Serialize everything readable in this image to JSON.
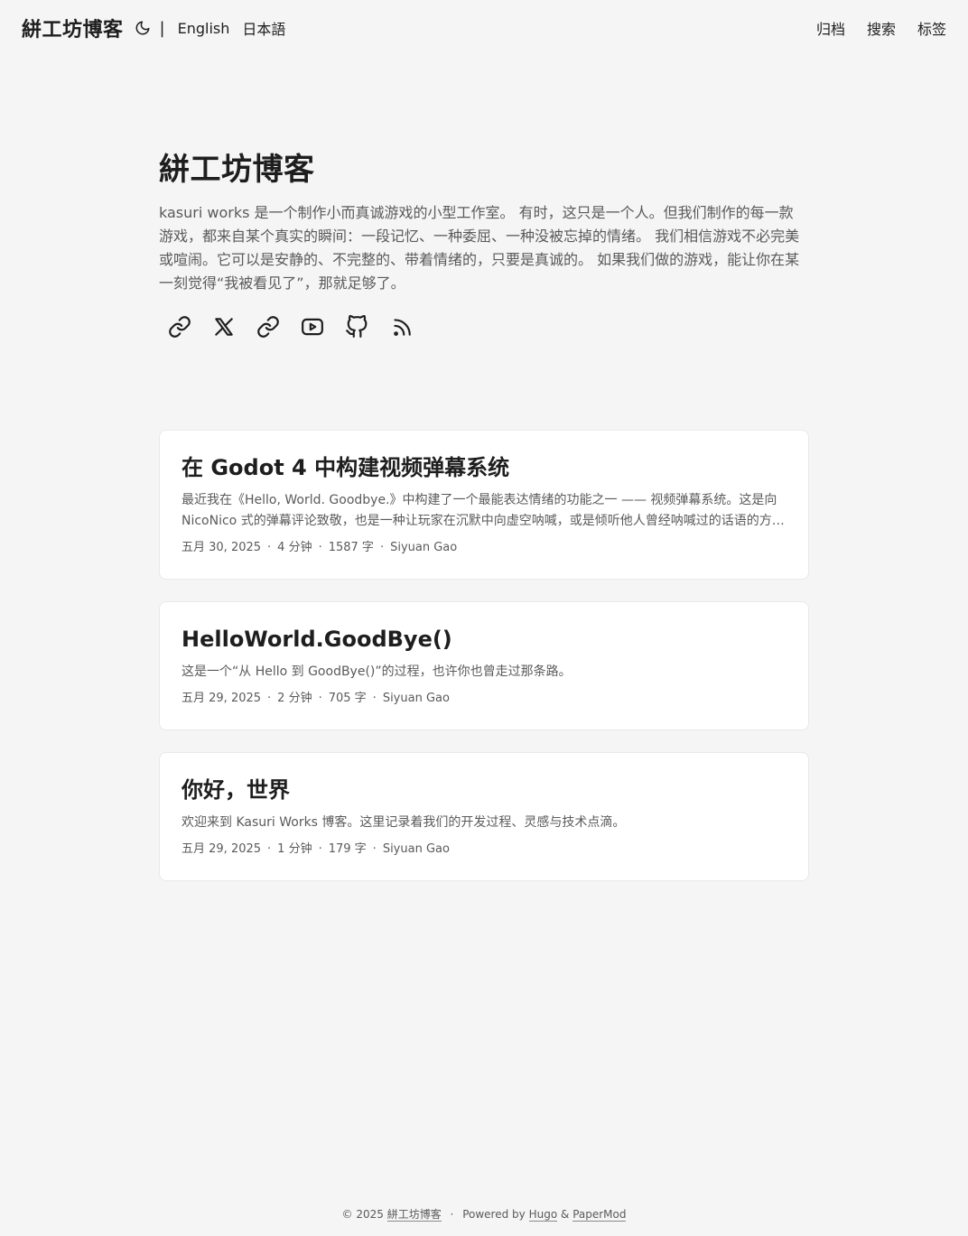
{
  "header": {
    "logo": "絣工坊博客",
    "divider": "|",
    "languages": [
      "English",
      "日本語"
    ],
    "menu": [
      "归档",
      "搜索",
      "标签"
    ]
  },
  "hero": {
    "title": "絣工坊博客",
    "description": "kasuri works 是一个制作小而真诚游戏的小型工作室。 有时，这只是一个人。但我们制作的每一款游戏，都来自某个真实的瞬间：一段记忆、一种委屈、一种没被忘掉的情绪。 我们相信游戏不必完美或喧闹。它可以是安静的、不完整的、带着情绪的，只要是真诚的。 如果我们做的游戏，能让你在某一刻觉得“我被看见了”，那就足够了。",
    "social_icons": [
      "link-icon",
      "x-icon",
      "link-icon",
      "youtube-icon",
      "github-icon",
      "rss-icon"
    ]
  },
  "posts": [
    {
      "title": "在 Godot 4 中构建视频弹幕系统",
      "summary": "最近我在《Hello, World. Goodbye.》中构建了一个最能表达情绪的功能之一 —— 视频弹幕系统。这是向 NicoNico 式的弹幕评论致敬，也是一种让玩家在沉默中向虚空呐喊，或是倾听他人曾经呐喊过的话语的方…",
      "date": "五月 30, 2025",
      "read_time": "4 分钟",
      "words": "1587 字",
      "author": "Siyuan Gao"
    },
    {
      "title": "HelloWorld.GoodBye()",
      "summary": "这是一个“从 Hello 到 GoodBye()”的过程，也许你也曾走过那条路。",
      "date": "五月 29, 2025",
      "read_time": "2 分钟",
      "words": "705 字",
      "author": "Siyuan Gao"
    },
    {
      "title": "你好，世界",
      "summary": "欢迎来到 Kasuri Works 博客。这里记录着我们的开发过程、灵感与技术点滴。",
      "date": "五月 29, 2025",
      "read_time": "1 分钟",
      "words": "179 字",
      "author": "Siyuan Gao"
    }
  ],
  "meta_separator": "·",
  "footer": {
    "copyright": "© 2025",
    "site_link": "絣工坊博客",
    "separator": "·",
    "powered_by": "Powered by",
    "hugo": "Hugo",
    "amp": "&",
    "papermod": "PaperMod"
  }
}
